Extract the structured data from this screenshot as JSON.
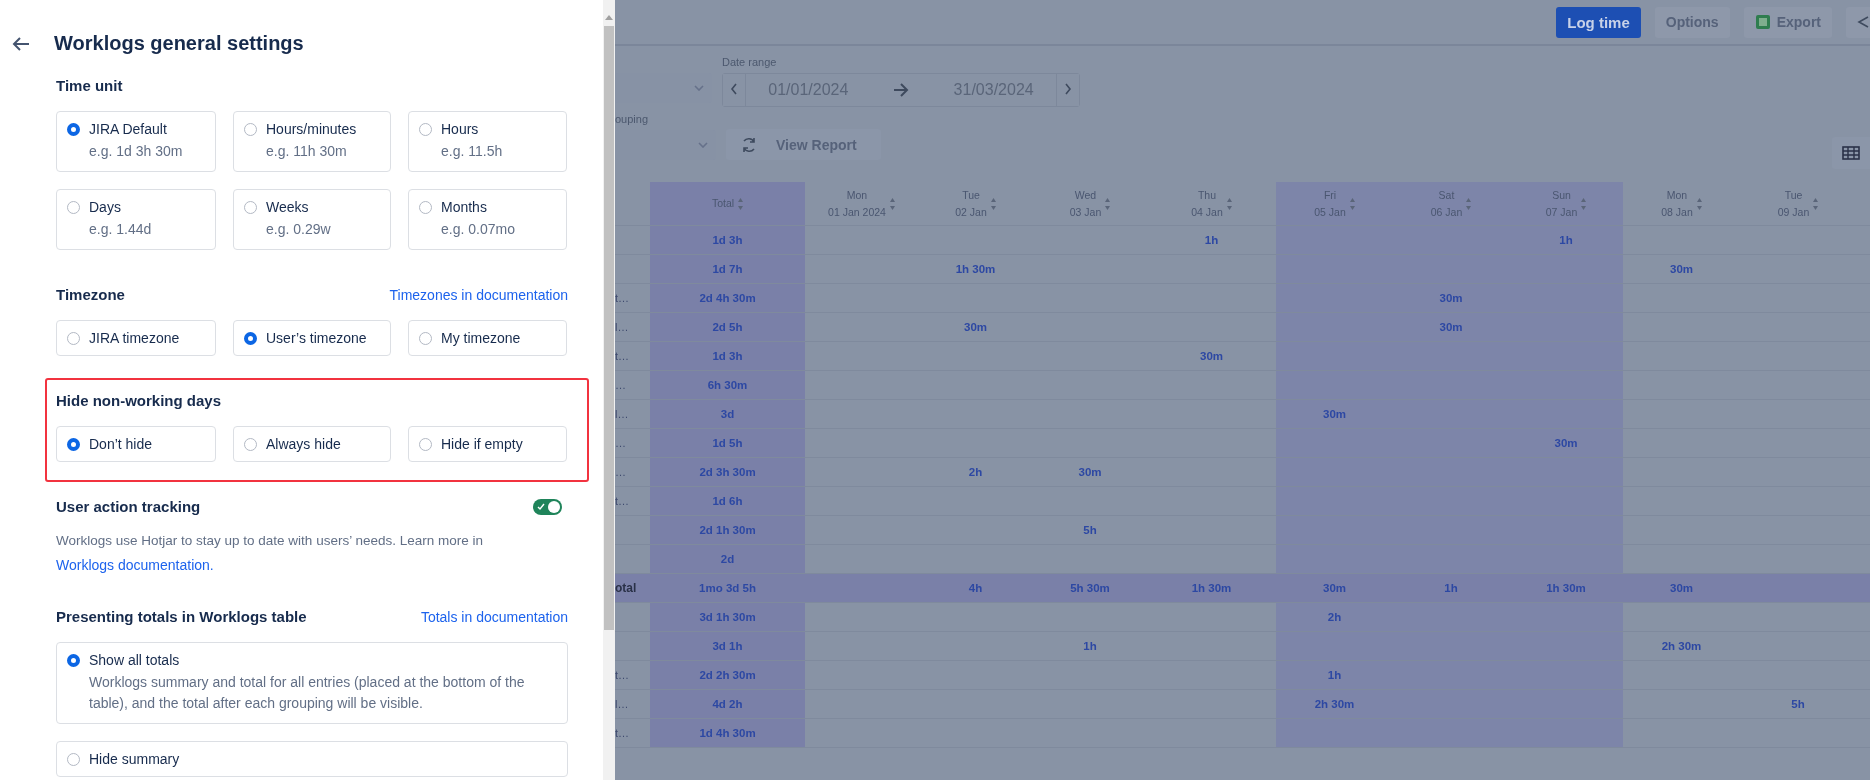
{
  "panel": {
    "title": "Worklogs general settings",
    "sections": [
      {
        "kind": "grid",
        "title": "Time unit",
        "highlighted": false,
        "options": [
          {
            "label": "JIRA Default",
            "example": "e.g. 1d 3h 30m",
            "selected": true
          },
          {
            "label": "Hours/minutes",
            "example": "e.g. 11h 30m",
            "selected": false
          },
          {
            "label": "Hours",
            "example": "e.g. 11.5h",
            "selected": false
          },
          {
            "label": "Days",
            "example": "e.g. 1.44d",
            "selected": false
          },
          {
            "label": "Weeks",
            "example": "e.g. 0.29w",
            "selected": false
          },
          {
            "label": "Months",
            "example": "e.g. 0.07mo",
            "selected": false
          }
        ]
      },
      {
        "kind": "grid",
        "title": "Timezone",
        "link": "Timezones in documentation",
        "highlighted": false,
        "options": [
          {
            "label": "JIRA timezone",
            "selected": false
          },
          {
            "label": "User’s timezone",
            "selected": true
          },
          {
            "label": "My timezone",
            "selected": false
          }
        ]
      },
      {
        "kind": "grid",
        "title": "Hide non-working days",
        "highlighted": true,
        "options": [
          {
            "label": "Don’t hide",
            "selected": true
          },
          {
            "label": "Always hide",
            "selected": false
          },
          {
            "label": "Hide if empty",
            "selected": false
          }
        ]
      },
      {
        "kind": "toggle",
        "title": "User action tracking",
        "on": true,
        "description": "Worklogs use Hotjar to stay up to date with users’ needs. Learn more in",
        "link": "Worklogs documentation."
      },
      {
        "kind": "list",
        "title": "Presenting totals in Worklogs table",
        "link": "Totals in documentation",
        "highlighted": false,
        "options": [
          {
            "label": "Show all totals",
            "example": "Worklogs summary and total for all entries (placed at the bottom of the table), and the total after each grouping will be visible.",
            "selected": true
          },
          {
            "label": "Hide summary",
            "selected": false
          }
        ]
      }
    ]
  },
  "report": {
    "toolbar": [
      {
        "label": "Log time",
        "kind": "primary"
      },
      {
        "label": "Options",
        "kind": "plain"
      },
      {
        "label": "Export",
        "kind": "export"
      },
      {
        "kind": "share"
      }
    ],
    "filters": {
      "date_label": "Date range",
      "start": "01/01/2024",
      "end": "31/03/2024",
      "grouping_label": "ouping",
      "view_report": "View Report"
    },
    "table": {
      "total_header": "Total",
      "columns": [
        {
          "day": "Mon",
          "date": "01 Jan 2024",
          "non_working": false
        },
        {
          "day": "Tue",
          "date": "02 Jan",
          "non_working": false
        },
        {
          "day": "Wed",
          "date": "03 Jan",
          "non_working": false
        },
        {
          "day": "Thu",
          "date": "04 Jan",
          "non_working": false
        },
        {
          "day": "Fri",
          "date": "05 Jan",
          "non_working": true
        },
        {
          "day": "Sat",
          "date": "06 Jan",
          "non_working": true
        },
        {
          "day": "Sun",
          "date": "07 Jan",
          "non_working": true
        },
        {
          "day": "Mon",
          "date": "08 Jan",
          "non_working": false
        },
        {
          "day": "Tue",
          "date": "09 Jan",
          "non_working": false
        }
      ],
      "rows": [
        {
          "kind": "row",
          "total": "1d 3h",
          "days": [
            {
              "kind": "blank"
            },
            {
              "kind": "blank"
            },
            {
              "kind": "blank"
            },
            {
              "kind": "time",
              "text": "1h"
            },
            {
              "kind": "blank"
            },
            {
              "kind": "blank"
            },
            {
              "kind": "time",
              "text": "1h"
            },
            {
              "kind": "blank"
            },
            {
              "kind": "blank"
            }
          ]
        },
        {
          "kind": "row",
          "total": "1d 7h",
          "days": [
            {
              "kind": "blank"
            },
            {
              "kind": "time",
              "text": "1h 30m"
            },
            {
              "kind": "blank"
            },
            {
              "kind": "blank"
            },
            {
              "kind": "blank"
            },
            {
              "kind": "blank"
            },
            {
              "kind": "blank"
            },
            {
              "kind": "time",
              "text": "30m"
            },
            {
              "kind": "blank"
            }
          ]
        },
        {
          "kind": "row",
          "label": "t…",
          "total": "2d 4h 30m",
          "days": [
            {
              "kind": "blank"
            },
            {
              "kind": "blank"
            },
            {
              "kind": "blank"
            },
            {
              "kind": "blank"
            },
            {
              "kind": "blank"
            },
            {
              "kind": "time",
              "text": "30m"
            },
            {
              "kind": "blank"
            },
            {
              "kind": "blank"
            },
            {
              "kind": "blank"
            }
          ]
        },
        {
          "kind": "row",
          "label": "l…",
          "total": "2d 5h",
          "days": [
            {
              "kind": "blank"
            },
            {
              "kind": "time",
              "text": "30m"
            },
            {
              "kind": "blank"
            },
            {
              "kind": "blank"
            },
            {
              "kind": "blank"
            },
            {
              "kind": "time",
              "text": "30m"
            },
            {
              "kind": "blank"
            },
            {
              "kind": "blank"
            },
            {
              "kind": "blank"
            }
          ]
        },
        {
          "kind": "row",
          "label": "t…",
          "total": "1d 3h",
          "days": [
            {
              "kind": "blank"
            },
            {
              "kind": "blank"
            },
            {
              "kind": "blank"
            },
            {
              "kind": "time",
              "text": "30m"
            },
            {
              "kind": "blank"
            },
            {
              "kind": "blank"
            },
            {
              "kind": "blank"
            },
            {
              "kind": "blank"
            },
            {
              "kind": "blank"
            }
          ]
        },
        {
          "kind": "row",
          "label": "…",
          "total": "6h 30m",
          "days": [
            {
              "kind": "blank"
            },
            {
              "kind": "blank"
            },
            {
              "kind": "blank"
            },
            {
              "kind": "blank"
            },
            {
              "kind": "blank"
            },
            {
              "kind": "blank"
            },
            {
              "kind": "blank"
            },
            {
              "kind": "blank"
            },
            {
              "kind": "blank"
            }
          ]
        },
        {
          "kind": "row",
          "label": "l…",
          "total": "3d",
          "days": [
            {
              "kind": "blank"
            },
            {
              "kind": "blank"
            },
            {
              "kind": "blank"
            },
            {
              "kind": "blank"
            },
            {
              "kind": "time",
              "text": "30m"
            },
            {
              "kind": "blank"
            },
            {
              "kind": "blank"
            },
            {
              "kind": "blank"
            },
            {
              "kind": "blank"
            }
          ]
        },
        {
          "kind": "row",
          "label": "…",
          "total": "1d 5h",
          "days": [
            {
              "kind": "blank"
            },
            {
              "kind": "blank"
            },
            {
              "kind": "blank"
            },
            {
              "kind": "blank"
            },
            {
              "kind": "blank"
            },
            {
              "kind": "blank"
            },
            {
              "kind": "time",
              "text": "30m"
            },
            {
              "kind": "blank"
            },
            {
              "kind": "blank"
            }
          ]
        },
        {
          "kind": "row",
          "label": "…",
          "total": "2d 3h 30m",
          "days": [
            {
              "kind": "blank"
            },
            {
              "kind": "time",
              "text": "2h"
            },
            {
              "kind": "time",
              "text": "30m"
            },
            {
              "kind": "blank"
            },
            {
              "kind": "blank"
            },
            {
              "kind": "blank"
            },
            {
              "kind": "blank"
            },
            {
              "kind": "blank"
            },
            {
              "kind": "blank"
            }
          ]
        },
        {
          "kind": "row",
          "label": "t…",
          "total": "1d 6h",
          "days": [
            {
              "kind": "blank"
            },
            {
              "kind": "blank"
            },
            {
              "kind": "blank"
            },
            {
              "kind": "blank"
            },
            {
              "kind": "blank"
            },
            {
              "kind": "blank"
            },
            {
              "kind": "blank"
            },
            {
              "kind": "blank"
            },
            {
              "kind": "blank"
            }
          ]
        },
        {
          "kind": "row",
          "total": "2d 1h 30m",
          "days": [
            {
              "kind": "blank"
            },
            {
              "kind": "blank"
            },
            {
              "kind": "time",
              "text": "5h"
            },
            {
              "kind": "blank"
            },
            {
              "kind": "blank"
            },
            {
              "kind": "blank"
            },
            {
              "kind": "blank"
            },
            {
              "kind": "blank"
            },
            {
              "kind": "blank"
            }
          ]
        },
        {
          "kind": "row",
          "total": "2d",
          "days": [
            {
              "kind": "blank"
            },
            {
              "kind": "blank"
            },
            {
              "kind": "blank"
            },
            {
              "kind": "blank"
            },
            {
              "kind": "blank"
            },
            {
              "kind": "blank"
            },
            {
              "kind": "blank"
            },
            {
              "kind": "blank"
            },
            {
              "kind": "blank"
            }
          ]
        },
        {
          "kind": "total",
          "label": "otal",
          "total": "1mo 3d 5h",
          "days": [
            {
              "kind": "blank"
            },
            {
              "kind": "time",
              "text": "4h"
            },
            {
              "kind": "time",
              "text": "5h 30m"
            },
            {
              "kind": "time",
              "text": "1h 30m"
            },
            {
              "kind": "time",
              "text": "30m"
            },
            {
              "kind": "time",
              "text": "1h"
            },
            {
              "kind": "time",
              "text": "1h 30m"
            },
            {
              "kind": "time",
              "text": "30m"
            },
            {
              "kind": "blank"
            }
          ]
        },
        {
          "kind": "row",
          "total": "3d 1h 30m",
          "days": [
            {
              "kind": "blank"
            },
            {
              "kind": "blank"
            },
            {
              "kind": "blank"
            },
            {
              "kind": "blank"
            },
            {
              "kind": "time",
              "text": "2h"
            },
            {
              "kind": "blank"
            },
            {
              "kind": "blank"
            },
            {
              "kind": "blank"
            },
            {
              "kind": "blank"
            }
          ]
        },
        {
          "kind": "row",
          "total": "3d 1h",
          "days": [
            {
              "kind": "blank"
            },
            {
              "kind": "blank"
            },
            {
              "kind": "time",
              "text": "1h"
            },
            {
              "kind": "blank"
            },
            {
              "kind": "blank"
            },
            {
              "kind": "blank"
            },
            {
              "kind": "blank"
            },
            {
              "kind": "time",
              "text": "2h 30m"
            },
            {
              "kind": "blank"
            }
          ]
        },
        {
          "kind": "row",
          "label": "t…",
          "total": "2d 2h 30m",
          "days": [
            {
              "kind": "blank"
            },
            {
              "kind": "blank"
            },
            {
              "kind": "blank"
            },
            {
              "kind": "blank"
            },
            {
              "kind": "time",
              "text": "1h"
            },
            {
              "kind": "blank"
            },
            {
              "kind": "blank"
            },
            {
              "kind": "blank"
            },
            {
              "kind": "blank"
            }
          ]
        },
        {
          "kind": "row",
          "label": "l…",
          "total": "4d 2h",
          "days": [
            {
              "kind": "blank"
            },
            {
              "kind": "blank"
            },
            {
              "kind": "blank"
            },
            {
              "kind": "blank"
            },
            {
              "kind": "time",
              "text": "2h 30m"
            },
            {
              "kind": "blank"
            },
            {
              "kind": "blank"
            },
            {
              "kind": "blank"
            },
            {
              "kind": "time",
              "text": "5h"
            }
          ]
        },
        {
          "kind": "row",
          "label": "t…",
          "total": "1d 4h 30m",
          "days": [
            {
              "kind": "blank"
            },
            {
              "kind": "blank"
            },
            {
              "kind": "blank"
            },
            {
              "kind": "blank"
            },
            {
              "kind": "blank"
            },
            {
              "kind": "blank"
            },
            {
              "kind": "blank"
            },
            {
              "kind": "blank"
            },
            {
              "kind": "blank"
            }
          ]
        }
      ]
    }
  }
}
